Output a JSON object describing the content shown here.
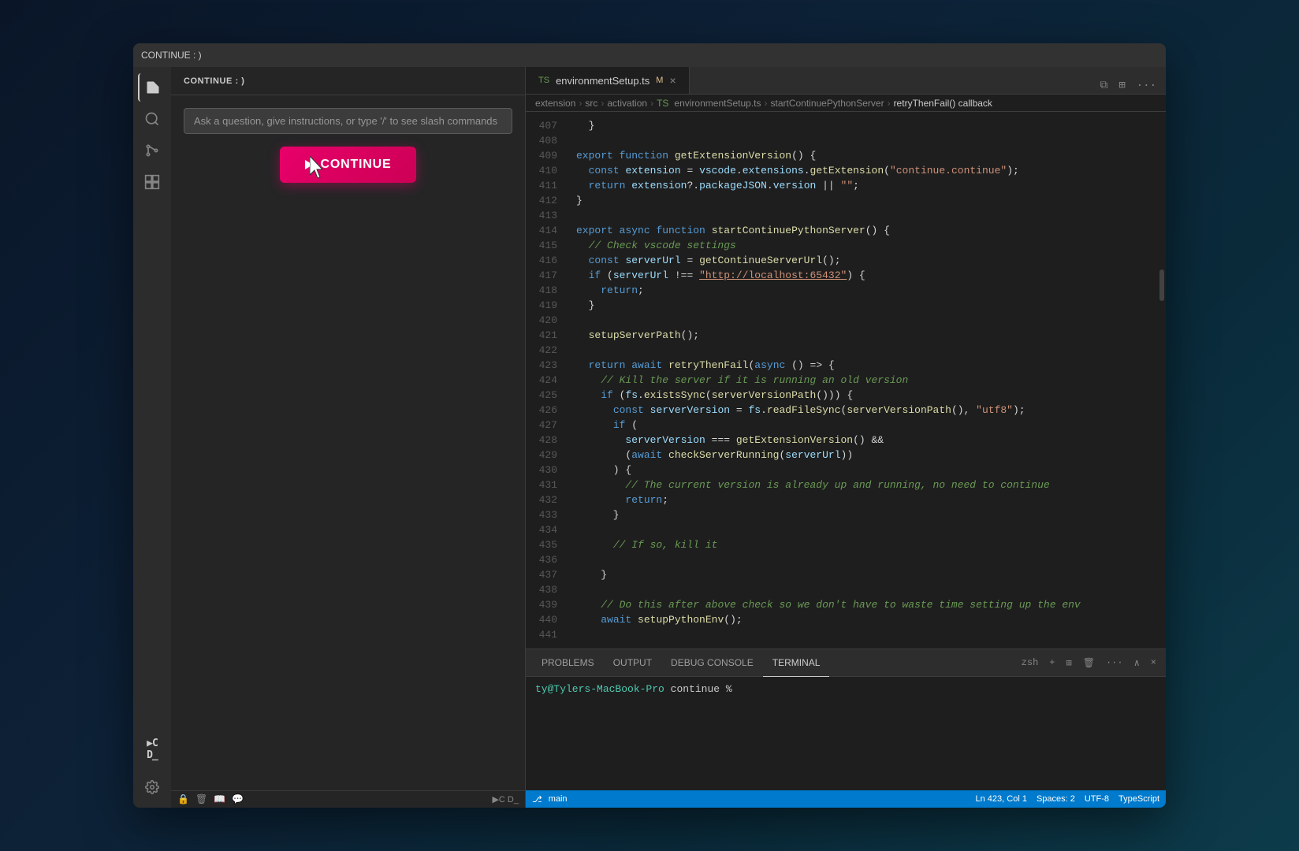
{
  "window": {
    "title": "CONTINUE : )"
  },
  "sidebar": {
    "title": "CONTINUE : )",
    "search_placeholder": "Ask a question, give instructions, or type '/' to see slash commands",
    "continue_button_label": "CONTINUE"
  },
  "editor": {
    "tab_filename": "environmentSetup.ts",
    "tab_modified": "M",
    "tab_lang": "TS",
    "breadcrumb": {
      "items": [
        "extension",
        "src",
        "activation",
        "TS environmentSetup.ts",
        "startContinuePythonServer",
        "retryThenFail() callback"
      ]
    },
    "lines": [
      {
        "num": 407,
        "code": "  }"
      },
      {
        "num": 408,
        "code": ""
      },
      {
        "num": 409,
        "code": "export function getExtensionVersion() {"
      },
      {
        "num": 410,
        "code": "  const extension = vscode.extensions.getExtension(\"continue.continue\");"
      },
      {
        "num": 411,
        "code": "  return extension?.packageJSON.version || \"\";"
      },
      {
        "num": 412,
        "code": "}"
      },
      {
        "num": 413,
        "code": ""
      },
      {
        "num": 414,
        "code": "export async function startContinuePythonServer() {"
      },
      {
        "num": 415,
        "code": "  // Check vscode settings"
      },
      {
        "num": 416,
        "code": "  const serverUrl = getContinueServerUrl();"
      },
      {
        "num": 417,
        "code": "  if (serverUrl !== \"http://localhost:65432\") {"
      },
      {
        "num": 418,
        "code": "    return;"
      },
      {
        "num": 419,
        "code": "  }"
      },
      {
        "num": 420,
        "code": ""
      },
      {
        "num": 421,
        "code": "  setupServerPath();"
      },
      {
        "num": 422,
        "code": ""
      },
      {
        "num": 423,
        "code": "  return await retryThenFail(async () => {"
      },
      {
        "num": 424,
        "code": "    // Kill the server if it is running an old version"
      },
      {
        "num": 425,
        "code": "    if (fs.existsSync(serverVersionPath())) {"
      },
      {
        "num": 426,
        "code": "      const serverVersion = fs.readFileSync(serverVersionPath(), \"utf8\");"
      },
      {
        "num": 427,
        "code": "      if ("
      },
      {
        "num": 428,
        "code": "        serverVersion === getExtensionVersion() &&"
      },
      {
        "num": 429,
        "code": "        (await checkServerRunning(serverUrl))"
      },
      {
        "num": 430,
        "code": "      ) {"
      },
      {
        "num": 431,
        "code": "        // The current version is already up and running, no need to continue"
      },
      {
        "num": 432,
        "code": "        return;"
      },
      {
        "num": 433,
        "code": "      }"
      },
      {
        "num": 434,
        "code": ""
      },
      {
        "num": 435,
        "code": "      // If so, kill it"
      },
      {
        "num": 436,
        "code": ""
      },
      {
        "num": 437,
        "code": "    }"
      },
      {
        "num": 438,
        "code": ""
      },
      {
        "num": 439,
        "code": "    // Do this after above check so we don't have to waste time setting up the env"
      },
      {
        "num": 440,
        "code": "    await setupPythonEnv();"
      },
      {
        "num": 441,
        "code": ""
      }
    ]
  },
  "bottom_panel": {
    "tabs": [
      "PROBLEMS",
      "OUTPUT",
      "DEBUG CONSOLE",
      "TERMINAL"
    ],
    "active_tab": "TERMINAL",
    "terminal_prompt": "ty@Tylers-MacBook-Pro continue %",
    "terminal_shell": "zsh"
  },
  "status_bar": {
    "left_items": [
      "⎇",
      "main"
    ],
    "right_items": [
      "Ln 423, Col 1",
      "Spaces: 2",
      "UTF-8",
      "TypeScript"
    ]
  },
  "activity_icons": {
    "explorer": "🗂",
    "search": "🔍",
    "source_control": "⎇",
    "extensions": "⊞",
    "continue": "▶"
  }
}
